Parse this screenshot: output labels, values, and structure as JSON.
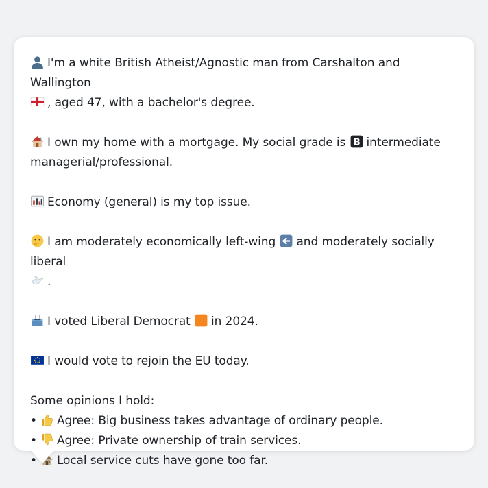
{
  "profile": {
    "line1_text": "I'm a white British Atheist/Agnostic man from Carshalton and Wallington",
    "line1_cont": ", aged 47, with a bachelor's degree.",
    "home_text": "I own my home with a mortgage. My social grade is",
    "grade_desc": "intermediate",
    "grade_desc_cont": "managerial/professional.",
    "issue_text": "Economy (general) is my top issue.",
    "ideology_text_a": "I am moderately economically left-wing",
    "ideology_text_b": "and moderately socially liberal",
    "ideology_end": ".",
    "vote_text_a": "I voted Liberal Democrat",
    "vote_text_b": "in 2024.",
    "eu_text": "I would vote to rejoin the EU today.",
    "opinions_heading": "Some opinions I hold:",
    "opinions": [
      {
        "bullet": "•",
        "icon": "thumbs-up-icon",
        "text": "Agree: Big business takes advantage of ordinary people."
      },
      {
        "bullet": "•",
        "icon": "thumbs-down-icon",
        "text": "Agree: Private ownership of train services."
      },
      {
        "bullet": "•",
        "icon": "derelict-house-icon",
        "text": "Local service cuts have gone too far."
      }
    ]
  },
  "icons": {
    "person": "bust-silhouette-icon",
    "flag": "england-flag-icon",
    "home": "house-icon",
    "grade": "letter-b-icon",
    "issue": "chart-icon",
    "thinking": "thinking-face-icon",
    "left": "left-arrow-icon",
    "liberal": "dove-icon",
    "vote": "ballot-box-icon",
    "party": "orange-square-icon",
    "eu": "eu-flag-icon"
  },
  "colors": {
    "background": "#f1f2f4",
    "bubble": "#ffffff",
    "text": "#1f2328",
    "libdem_orange": "#f5861f",
    "eu_blue": "#003399"
  }
}
